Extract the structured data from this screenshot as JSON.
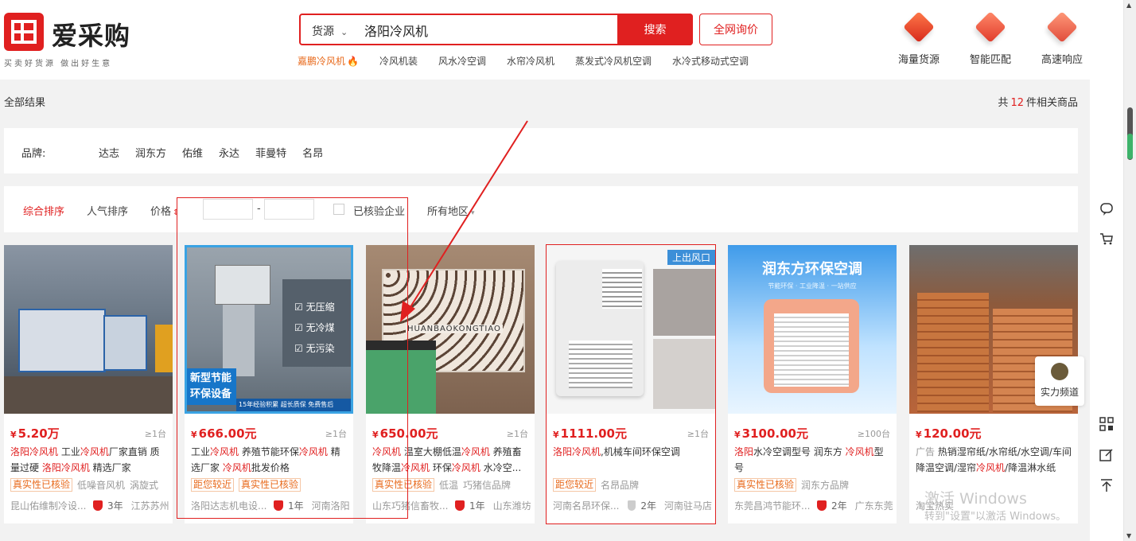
{
  "header": {
    "logo_text": "爱采购",
    "slogan": "买卖好货源  做出好生意",
    "search_type": "货源",
    "search_value": "洛阳冷风机",
    "search_button": "搜索",
    "inquiry_button": "全网询价",
    "hot_words": [
      "嘉鹏冷风机",
      "冷风机装",
      "风水冷空调",
      "水帘冷风机",
      "蒸发式冷风机空调",
      "水冷式移动式空调"
    ],
    "features": [
      "海量货源",
      "智能匹配",
      "高速响应"
    ]
  },
  "results": {
    "all_label": "全部结果",
    "count_prefix": "共",
    "count": "12",
    "count_suffix": "件相关商品"
  },
  "brands": {
    "label": "品牌:",
    "items": [
      "达志",
      "润东方",
      "佑维",
      "永达",
      "菲曼特",
      "名昂"
    ]
  },
  "sort": {
    "comprehensive": "综合排序",
    "popularity": "人气排序",
    "price": "价格",
    "dash": "-",
    "verified": "已核验企业",
    "region": "所有地区"
  },
  "products": [
    {
      "price": "5.20万",
      "moq": "≥1台",
      "title_parts": [
        [
          "洛阳冷风机",
          true
        ],
        [
          " 工业",
          false
        ],
        [
          "冷风机",
          true
        ],
        [
          "厂家直销 质量过硬 ",
          false
        ],
        [
          "洛阳冷风机",
          true
        ],
        [
          " 精选厂家",
          false
        ]
      ],
      "tags": [
        "真实性已核验"
      ],
      "plain_tags": [
        "低噪音风机",
        "涡旋式"
      ],
      "seller": "昆山佑维制冷设...",
      "years": "3年",
      "location": "江苏苏州",
      "badge": "red",
      "colors": [
        "#5a6b86",
        "#2a3a52"
      ]
    },
    {
      "price": "666.00元",
      "moq": "≥1台",
      "title_parts": [
        [
          "工业",
          false
        ],
        [
          "冷风机",
          true
        ],
        [
          " 养殖节能环保",
          false
        ],
        [
          "冷风机",
          true
        ],
        [
          " 精选厂家 ",
          false
        ],
        [
          "冷风机",
          true
        ],
        [
          "批发价格",
          false
        ]
      ],
      "tags": [
        "距您较近",
        "真实性已核验"
      ],
      "plain_tags": [],
      "seller": "洛阳达志机电设...",
      "years": "1年",
      "location": "河南洛阳",
      "badge": "red",
      "overlay_lines": [
        "无压缩",
        "无冷煤",
        "无污染"
      ],
      "banner_main": "新型节能",
      "banner_sub": "环保设备",
      "banner_foot": "15年经验积累  超长质保  免费售后",
      "colors": [
        "#7d8a97",
        "#4a5663"
      ]
    },
    {
      "price": "650.00元",
      "moq": "≥1台",
      "title_parts": [
        [
          "冷风机",
          true
        ],
        [
          " 温室大棚低温",
          false
        ],
        [
          "冷风机",
          true
        ],
        [
          " 养殖畜牧降温",
          false
        ],
        [
          "冷风机",
          true
        ],
        [
          " 环保",
          false
        ],
        [
          "冷风机",
          true
        ],
        [
          " 水冷空...",
          false
        ]
      ],
      "tags": [
        "真实性已核验"
      ],
      "plain_tags": [
        "低温",
        "巧猪信品牌"
      ],
      "seller": "山东巧猪信畜牧...",
      "years": "1年",
      "location": "山东潍坊",
      "badge": "red",
      "img_text": "HUANBAOKONGTIAO",
      "colors": [
        "#8b6b55",
        "#4e3a2e"
      ]
    },
    {
      "price": "1111.00元",
      "moq": "≥1台",
      "title_parts": [
        [
          "洛阳冷风机",
          true
        ],
        [
          ",机械车间环保空调",
          false
        ]
      ],
      "tags": [
        "距您较近"
      ],
      "plain_tags": [
        "名昂品牌"
      ],
      "seller": "河南名昂环保...",
      "years": "2年",
      "location": "河南驻马店",
      "badge": "grey",
      "ribbon": "上出风口",
      "colors": [
        "#eeeeee",
        "#cfcfcf"
      ]
    },
    {
      "price": "3100.00元",
      "moq": "≥100台",
      "title_parts": [
        [
          "洛阳",
          true
        ],
        [
          "水冷空调型号 润东方 ",
          false
        ],
        [
          "冷风机",
          true
        ],
        [
          "型号",
          false
        ]
      ],
      "tags": [
        "真实性已核验"
      ],
      "plain_tags": [
        "润东方品牌"
      ],
      "seller": "东莞昌鸿节能环...",
      "years": "2年",
      "location": "广东东莞",
      "badge": "red",
      "img_title": "润东方环保空调",
      "img_sub": "节能环保 · 工业降温 · 一站供应",
      "colors": [
        "#2a8fe0",
        "#bfe3ff"
      ]
    },
    {
      "price": "120.00元",
      "moq": "",
      "title_parts": [
        [
          "广告 ",
          false
        ],
        [
          "热销湿帘纸/水帘纸/水空调/车间降温空调/湿帘",
          false
        ],
        [
          "冷风机",
          true
        ],
        [
          "/降温淋水纸",
          false
        ]
      ],
      "tags": [],
      "plain_tags": [],
      "seller": "淘宝热卖",
      "years": "",
      "location": "",
      "badge": "none",
      "float_badge": "实力频道",
      "colors": [
        "#b9643a",
        "#7a3f22"
      ]
    }
  ],
  "watermark": {
    "line1": "激活 Windows",
    "line2": "转到\"设置\"以激活 Windows。"
  },
  "sidebar_icons": [
    "chat-icon",
    "cart-icon",
    "qrcode-icon",
    "edit-icon",
    "back-to-top-icon"
  ]
}
